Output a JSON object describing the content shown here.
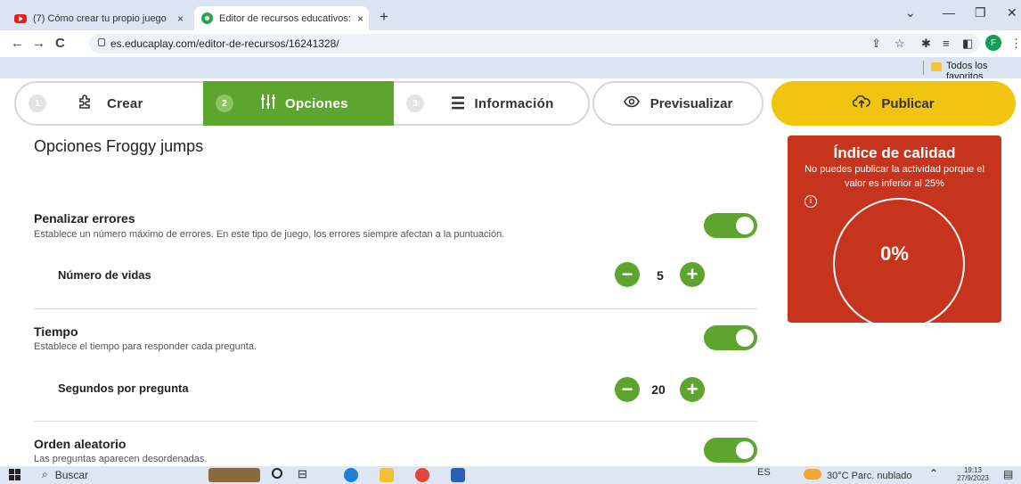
{
  "browser": {
    "tabs": [
      {
        "title": "(7) Cómo crear tu propio juego",
        "close": "×"
      },
      {
        "title": "Editor de recursos educativos:",
        "close": "×"
      }
    ],
    "new_tab": "+",
    "url": "es.educaplay.com/editor-de-recursos/16241328/",
    "profile_initial": "F",
    "bookmark": "Todos los favoritos"
  },
  "steps": [
    {
      "num": "1",
      "icon": "puzzle-icon",
      "label": "Crear"
    },
    {
      "num": "2",
      "icon": "sliders-icon",
      "label": "Opciones"
    },
    {
      "num": "3",
      "icon": "list-icon",
      "label": "Información"
    }
  ],
  "preview_label": "Previsualizar",
  "publish_label": "Publicar",
  "page_title": "Opciones Froggy jumps",
  "sections": {
    "penalize": {
      "title": "Penalizar errores",
      "desc": "Establece un número máximo de errores. En este tipo de juego, los errores siempre afectan a la puntuación.",
      "enabled": true,
      "sub_label": "Número de vidas",
      "value": "5"
    },
    "time": {
      "title": "Tiempo",
      "desc": "Establece el tiempo para responder cada pregunta.",
      "enabled": true,
      "sub_label": "Segundos por pregunta",
      "value": "20"
    },
    "random": {
      "title": "Orden aleatorio",
      "desc": "Las preguntas aparecen desordenadas.",
      "enabled": true
    }
  },
  "quality": {
    "title": "Índice de calidad",
    "message": "No puedes publicar la actividad porque el valor es inferior al 25%",
    "info": "i",
    "percent": "0%"
  },
  "taskbar": {
    "search_placeholder": "Buscar",
    "lang": "ES",
    "weather": "30°C  Parc. nublado",
    "time": "19:13",
    "date": "27/9/2023"
  },
  "colors": {
    "accent_green": "#5ea52f",
    "publish_yellow": "#f1c50f",
    "quality_red": "#c6341d"
  }
}
